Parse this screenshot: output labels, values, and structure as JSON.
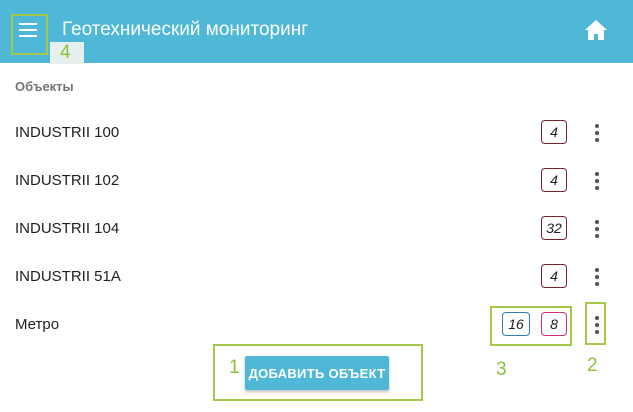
{
  "appbar": {
    "title": "Геотехнический мониторинг",
    "menu_icon": "hamburger-menu-icon",
    "home_icon": "home-icon"
  },
  "section": {
    "label": "Объекты"
  },
  "objects": [
    {
      "name": "INDUSTRII 100",
      "badges": [
        {
          "value": "4",
          "color": "#7a1f2b"
        }
      ]
    },
    {
      "name": "INDUSTRII 102",
      "badges": [
        {
          "value": "4",
          "color": "#7a1f2b"
        }
      ]
    },
    {
      "name": "INDUSTRII 104",
      "badges": [
        {
          "value": "32",
          "color": "#7a1f2b"
        }
      ]
    },
    {
      "name": "INDUSTRII 51A",
      "badges": [
        {
          "value": "4",
          "color": "#7a1f2b"
        }
      ]
    },
    {
      "name": "Метро",
      "badges": [
        {
          "value": "16",
          "color": "#2f7fc0"
        },
        {
          "value": "8",
          "color": "#d0307a"
        }
      ]
    }
  ],
  "add_button": {
    "label": "ДОБАВИТЬ ОБЪЕКТ"
  },
  "annotations": {
    "a1": "1",
    "a2": "2",
    "a3": "3",
    "a4": "4"
  },
  "colors": {
    "appbar": "#4fb8d6",
    "highlight": "#a5c84a"
  }
}
